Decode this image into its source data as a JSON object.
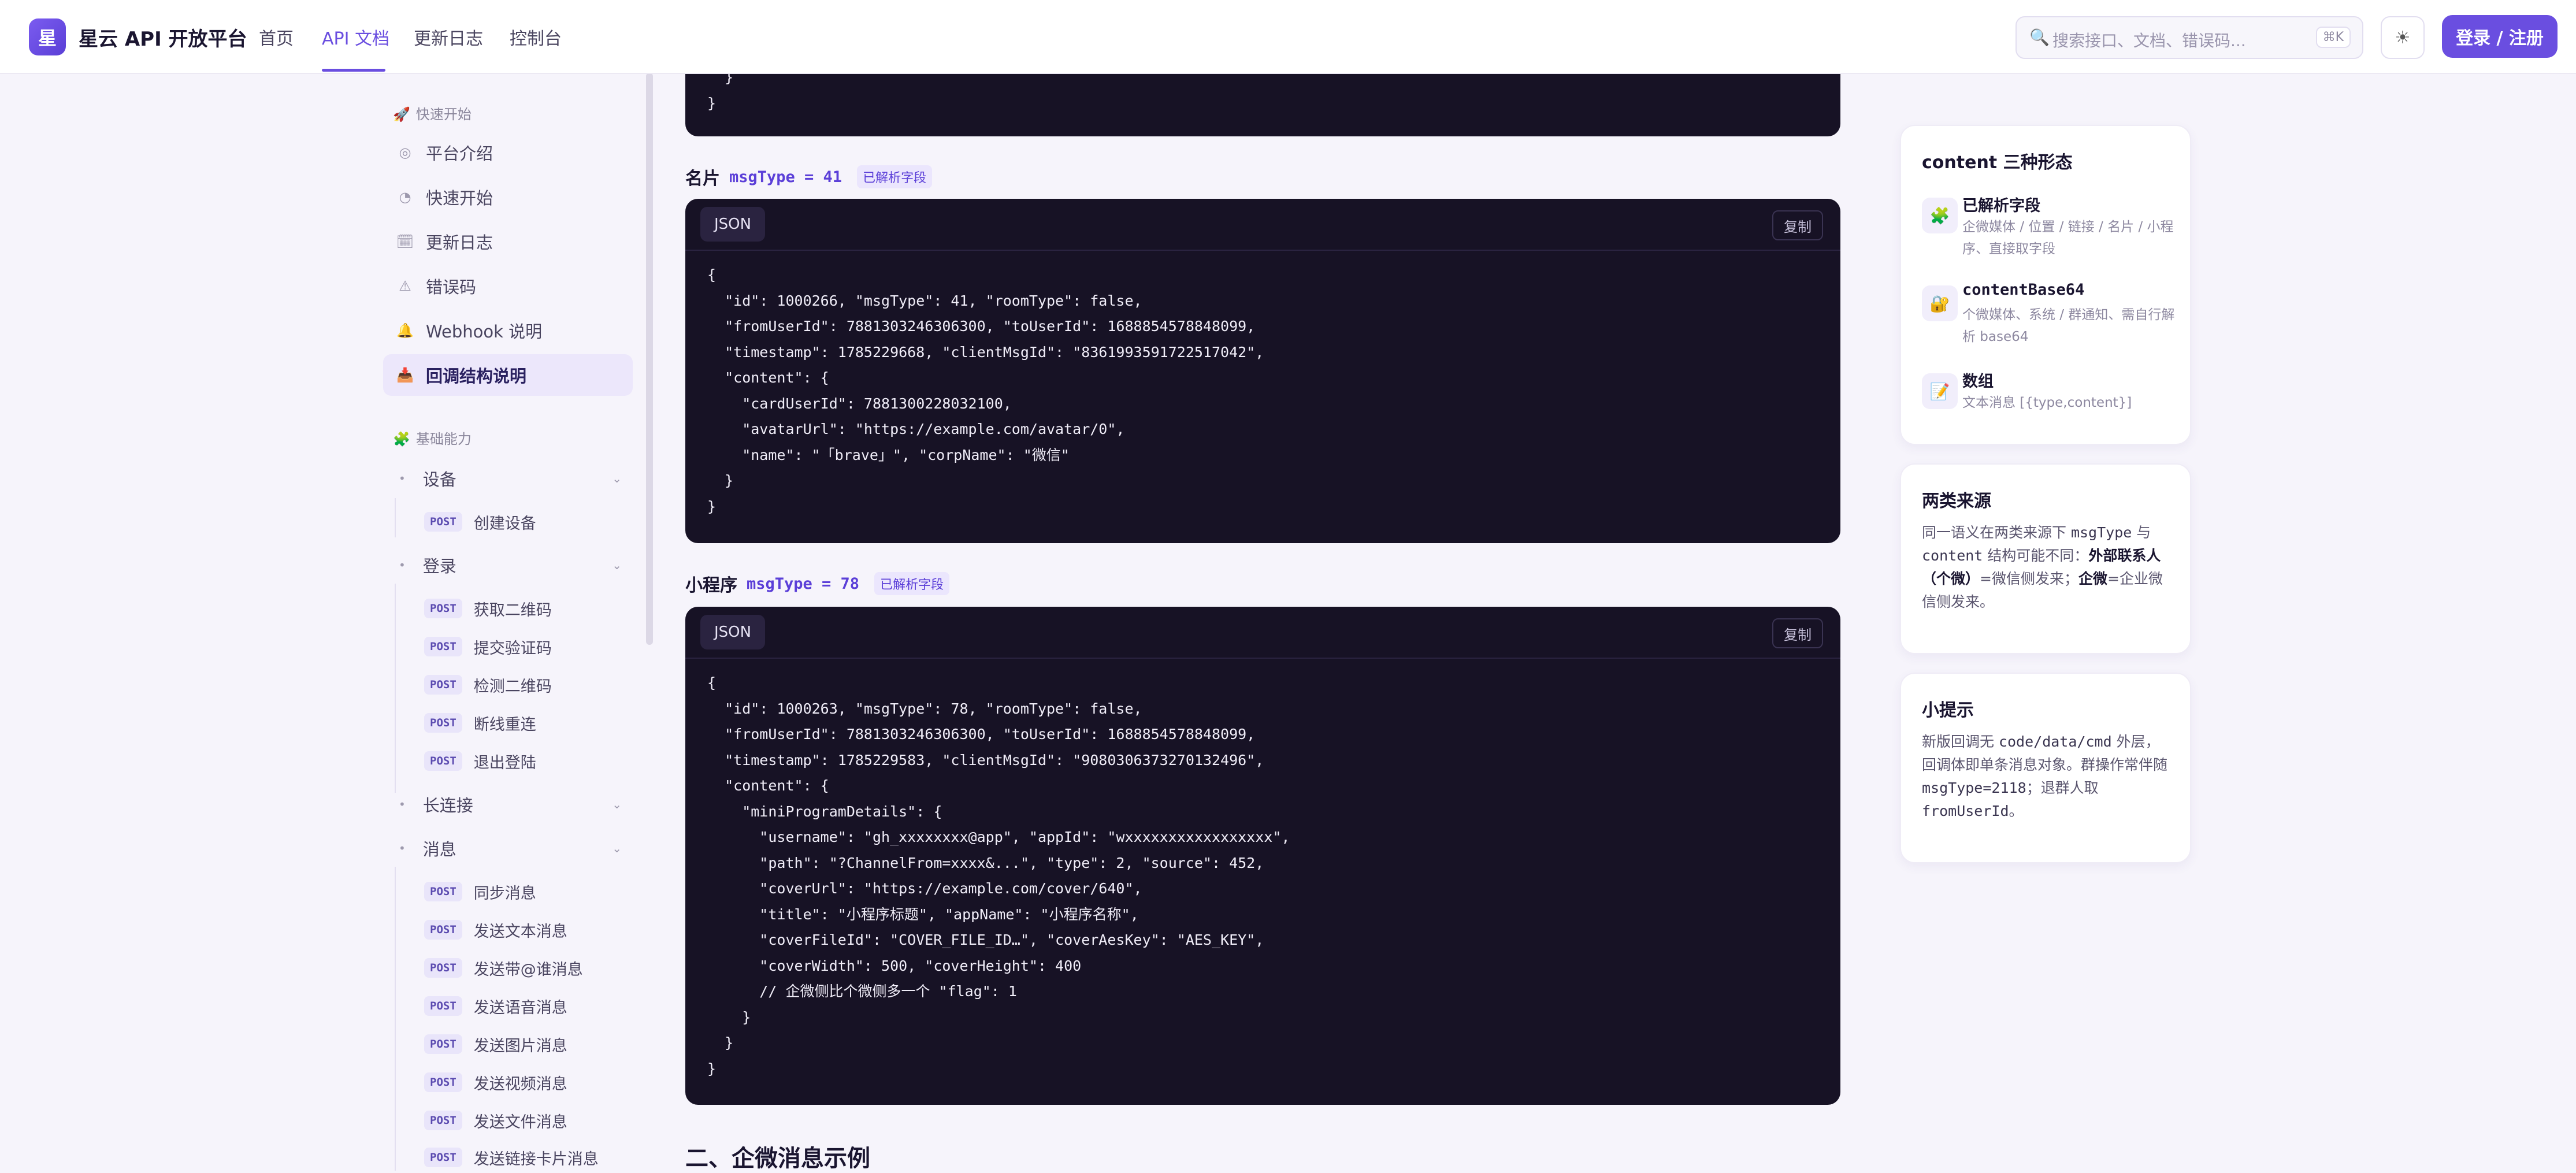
{
  "header": {
    "logo_char": "星",
    "brand": "星云 API 开放平台",
    "nav": [
      "首页",
      "API 文档",
      "更新日志",
      "控制台"
    ],
    "active_nav": "API 文档",
    "search_placeholder": "搜索接口、文档、错误码...",
    "search_shortcut": "⌘K",
    "theme_icon": "☀",
    "login_label": "登录 / 注册"
  },
  "sidebar": {
    "group_quickstart": "快速开始",
    "group_quickstart_icon": "🚀",
    "items": [
      {
        "icon": "◎",
        "label": "平台介绍"
      },
      {
        "icon": "◔",
        "label": "快速开始"
      },
      {
        "icon": "🗓",
        "label": "更新日志"
      },
      {
        "icon": "⚠",
        "label": "错误码"
      },
      {
        "icon": "🔔",
        "label": "Webhook 说明"
      },
      {
        "icon": "📥",
        "label": "回调结构说明"
      }
    ],
    "active_item": "回调结构说明",
    "group_basic": "基础能力",
    "group_basic_icon": "🧩",
    "cat_device": "设备",
    "cat_login": "登录",
    "cat_longconn": "长连接",
    "cat_message": "消息",
    "post_tag": "POST",
    "device_apis": [
      "创建设备"
    ],
    "login_apis": [
      "获取二维码",
      "提交验证码",
      "检测二维码",
      "断线重连",
      "退出登陆"
    ],
    "message_apis": [
      "同步消息",
      "发送文本消息",
      "发送带@谁消息",
      "发送语音消息",
      "发送图片消息",
      "发送视频消息",
      "发送文件消息",
      "发送链接卡片消息"
    ]
  },
  "main": {
    "top_block_lines": [
      "  }",
      "}"
    ],
    "card_section": {
      "title": "名片",
      "code": "msgType = 41",
      "tag": "已解析字段",
      "tab": "JSON",
      "copy": "复制",
      "lines": [
        "{",
        "  \"id\": 1000266, \"msgType\": 41, \"roomType\": false,",
        "  \"fromUserId\": 7881303246306300, \"toUserId\": 1688854578848099,",
        "  \"timestamp\": 1785229668, \"clientMsgId\": \"8361993591722517042\",",
        "  \"content\": {",
        "    \"cardUserId\": 7881300228032100,",
        "    \"avatarUrl\": \"https://example.com/avatar/0\",",
        "    \"name\": \"「brave」\", \"corpName\": \"微信\"",
        "  }",
        "}"
      ]
    },
    "mini_section": {
      "title": "小程序",
      "code": "msgType = 78",
      "tag": "已解析字段",
      "tab": "JSON",
      "copy": "复制",
      "lines": [
        "{",
        "  \"id\": 1000263, \"msgType\": 78, \"roomType\": false,",
        "  \"fromUserId\": 7881303246306300, \"toUserId\": 1688854578848099,",
        "  \"timestamp\": 1785229583, \"clientMsgId\": \"9080306373270132496\",",
        "  \"content\": {",
        "    \"miniProgramDetails\": {",
        "      \"username\": \"gh_xxxxxxxx@app\", \"appId\": \"wxxxxxxxxxxxxxxxxx\",",
        "      \"path\": \"?ChannelFrom=xxxx&...\", \"type\": 2, \"source\": 452,",
        "      \"coverUrl\": \"https://example.com/cover/640\",",
        "      \"title\": \"小程序标题\", \"appName\": \"小程序名称\",",
        "      \"coverFileId\": \"COVER_FILE_ID…\", \"coverAesKey\": \"AES_KEY\",",
        "      \"coverWidth\": 500, \"coverHeight\": 400",
        "      // 企微侧比个微侧多一个 \"flag\": 1",
        "    }",
        "  }",
        "}"
      ]
    },
    "next_heading": "二、企微消息示例"
  },
  "right": {
    "forms_title": "content 三种形态",
    "forms": [
      {
        "icon": "🧩",
        "name": "已解析字段",
        "desc": "企微媒体 / 位置 / 链接 / 名片 / 小程序、直接取字段"
      },
      {
        "icon": "🔐",
        "name": "contentBase64",
        "desc": "个微媒体、系统 / 群通知、需自行解析 base64"
      },
      {
        "icon": "📝",
        "name": "数组",
        "desc": "文本消息 [{type,content}]"
      }
    ],
    "sources_title": "两类来源",
    "sources_p1": "同一语义在两类来源下 ",
    "sources_code1": "msgType",
    "sources_p2": " 与 ",
    "sources_code2": "content",
    "sources_p3": " 结构可能不同：",
    "sources_b1": "外部联系人（个微）",
    "sources_p4": "=微信侧发来；",
    "sources_b2": "企微",
    "sources_p5": "=企业微信侧发来。",
    "tips_title": "小提示",
    "tips_p1": "新版回调无 ",
    "tips_code1": "code/data/cmd",
    "tips_p2": " 外层，回调体即单条消息对象。群操作常伴随 ",
    "tips_code2": "msgType=2118",
    "tips_p3": "；退群人取 ",
    "tips_code3": "fromUserId",
    "tips_p4": "。"
  }
}
